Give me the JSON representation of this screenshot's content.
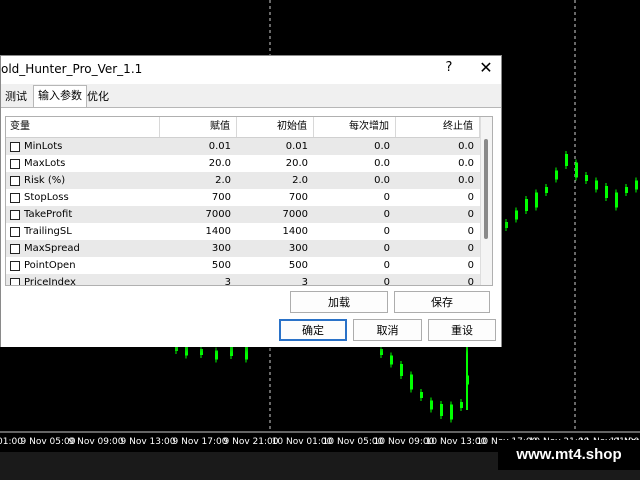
{
  "dialog": {
    "title": "old_Hunter_Pro_Ver_1.1",
    "help": "?",
    "close": "✕",
    "tabs": [
      {
        "label": "测试"
      },
      {
        "label": "输入参数"
      },
      {
        "label": "优化"
      }
    ],
    "table": {
      "headers": [
        "变量",
        "赋值",
        "初始值",
        "每次增加",
        "终止值"
      ],
      "rows": [
        {
          "name": "MinLots",
          "value": "0.01",
          "start": "0.01",
          "step": "0.0",
          "stop": "0.0"
        },
        {
          "name": "MaxLots",
          "value": "20.0",
          "start": "20.0",
          "step": "0.0",
          "stop": "0.0"
        },
        {
          "name": "Risk (%)",
          "value": "2.0",
          "start": "2.0",
          "step": "0.0",
          "stop": "0.0"
        },
        {
          "name": "StopLoss",
          "value": "700",
          "start": "700",
          "step": "0",
          "stop": "0"
        },
        {
          "name": "TakeProfit",
          "value": "7000",
          "start": "7000",
          "step": "0",
          "stop": "0"
        },
        {
          "name": "TrailingSL",
          "value": "1400",
          "start": "1400",
          "step": "0",
          "stop": "0"
        },
        {
          "name": "MaxSpread",
          "value": "300",
          "start": "300",
          "step": "0",
          "stop": "0"
        },
        {
          "name": "PointOpen",
          "value": "500",
          "start": "500",
          "step": "0",
          "stop": "0"
        },
        {
          "name": "PriceIndex",
          "value": "3",
          "start": "3",
          "step": "0",
          "stop": "0"
        }
      ]
    },
    "buttons": {
      "load": "加载",
      "save": "保存",
      "ok": "确定",
      "cancel": "取消",
      "reset": "重设"
    }
  },
  "chart": {
    "time_labels": [
      "01:00",
      "9 Nov 05:00",
      "9 Nov 09:00",
      "9 Nov 13:00",
      "9 Nov 17:00",
      "9 Nov 21:00",
      "10 Nov 01:00",
      "10 Nov 05:00",
      "10 Nov 09:00",
      "10 Nov 13:00",
      "10 Nov 17:00",
      "10 Nov 21:00",
      "11 Nov 01:00",
      "11 Nov 05:00"
    ],
    "candle_color": "#00ff00",
    "background": "#000000"
  },
  "watermark": "www.mt4.shop"
}
